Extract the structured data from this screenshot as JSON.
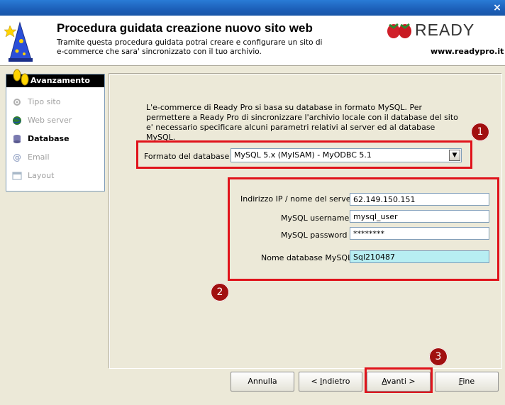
{
  "window": {
    "close_label": "×"
  },
  "header": {
    "title": "Procedura guidata creazione nuovo sito web",
    "description": "Tramite questa procedura guidata potrai creare e configurare un sito di e-commerce che sara' sincronizzato con il tuo archivio.",
    "brand": "READY",
    "website": "www.readypro.it"
  },
  "sidebar": {
    "heading": "Avanzamento",
    "items": [
      {
        "label": "Tipo sito",
        "icon": "gear-icon",
        "active": false
      },
      {
        "label": "Web server",
        "icon": "globe-icon",
        "active": false
      },
      {
        "label": "Database",
        "icon": "database-icon",
        "active": true
      },
      {
        "label": "Email",
        "icon": "at-icon",
        "active": false
      },
      {
        "label": "Layout",
        "icon": "layout-icon",
        "active": false
      }
    ]
  },
  "main": {
    "intro": "L'e-commerce di Ready Pro si basa su database in formato MySQL. Per permettere a Ready Pro di sincronizzare l'archivio locale con il database del sito e' necessario specificare alcuni parametri relativi al server ed al database MySQL.",
    "db_format": {
      "label": "Formato del database :",
      "value": "MySQL 5.x (MyISAM) - MyODBC 5.1"
    },
    "server": {
      "label": "Indirizzo IP / nome del server :",
      "value": "62.149.150.151"
    },
    "username": {
      "label": "MySQL username :",
      "value": "mysql_user"
    },
    "password": {
      "label": "MySQL password :",
      "value": "********"
    },
    "db_name": {
      "label": "Nome database MySQL :",
      "value": "Sql210487"
    }
  },
  "badges": [
    "1",
    "2",
    "3"
  ],
  "buttons": {
    "cancel": "Annulla",
    "back_prefix": "< ",
    "back_mnemonic": "I",
    "back_rest": "ndietro",
    "next_mnemonic": "A",
    "next_rest": "vanti >",
    "finish_mnemonic": "F",
    "finish_rest": "ine"
  },
  "colors": {
    "highlight": "#e0131b",
    "badge": "#a11010",
    "active_field": "#b7eef2"
  }
}
